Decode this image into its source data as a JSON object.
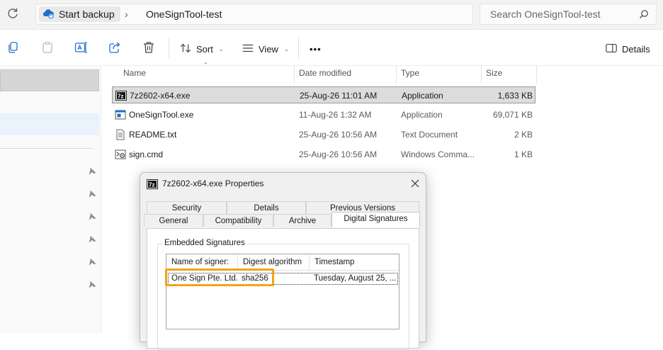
{
  "address": {
    "crumbs": [
      "Start backup",
      "OneSignTool-test"
    ],
    "separator": "›"
  },
  "search": {
    "placeholder": "Search OneSignTool-test"
  },
  "toolbar": {
    "sort_label": "Sort",
    "view_label": "View",
    "more_label": "•••",
    "details_label": "Details"
  },
  "columns": {
    "name": "Name",
    "date": "Date modified",
    "type": "Type",
    "size": "Size"
  },
  "files": [
    {
      "name": "7z2602-x64.exe",
      "date": "25-Aug-26 11:01 AM",
      "type": "Application",
      "size": "1,633 KB",
      "icon": "7zip-exe-icon",
      "selected": true
    },
    {
      "name": "OneSignTool.exe",
      "date": "11-Aug-26 1:32 AM",
      "type": "Application",
      "size": "69,071 KB",
      "icon": "app-exe-icon",
      "selected": false
    },
    {
      "name": "README.txt",
      "date": "25-Aug-26 10:56 AM",
      "type": "Text Document",
      "size": "2 KB",
      "icon": "text-file-icon",
      "selected": false
    },
    {
      "name": "sign.cmd",
      "date": "25-Aug-26 10:56 AM",
      "type": "Windows Comma...",
      "size": "1 KB",
      "icon": "cmd-file-icon",
      "selected": false
    }
  ],
  "dialog": {
    "title": "7z2602-x64.exe Properties",
    "tabs_back": [
      "Security",
      "Details",
      "Previous Versions"
    ],
    "tabs_front": [
      "General",
      "Compatibility",
      "Archive",
      "Digital Signatures"
    ],
    "active_tab": "Digital Signatures",
    "group_title": "Embedded Signatures",
    "list_headers": [
      "Name of signer:",
      "Digest algorithm",
      "Timestamp"
    ],
    "signatures": [
      {
        "signer": "One Sign Pte. Ltd.",
        "digest": "sha256",
        "timestamp": "Tuesday, August 25, ..."
      }
    ]
  },
  "colors": {
    "highlight": "#f0a418",
    "selection": "#dcdcdc",
    "accent": "#0067c0"
  }
}
